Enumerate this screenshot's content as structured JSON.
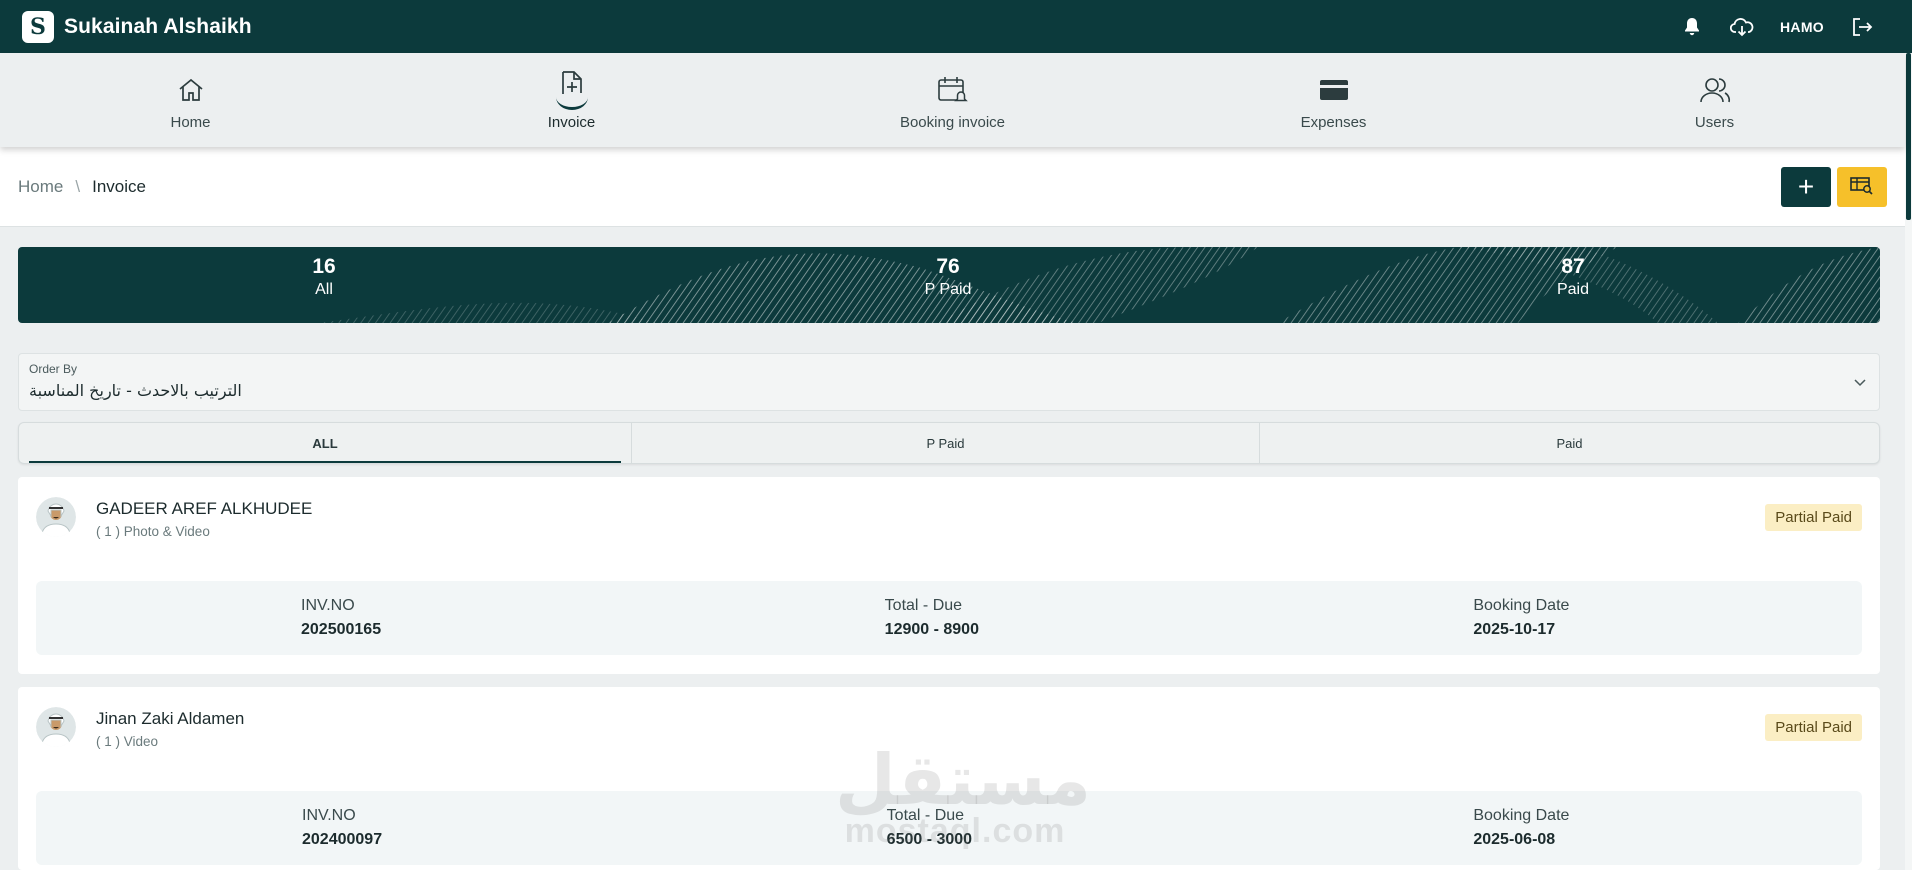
{
  "app": {
    "title": "Sukainah Alshaikh",
    "logo_letter": "S",
    "user": "HAMO"
  },
  "nav": {
    "items": [
      {
        "label": "Home",
        "icon": "home-icon"
      },
      {
        "label": "Invoice",
        "icon": "invoice-add-icon"
      },
      {
        "label": "Booking invoice",
        "icon": "calendar-bell-icon"
      },
      {
        "label": "Expenses",
        "icon": "wallet-card-icon"
      },
      {
        "label": "Users",
        "icon": "users-icon"
      }
    ]
  },
  "breadcrumb": {
    "home": "Home",
    "separator": "\\",
    "current": "Invoice"
  },
  "actions": {
    "add_label": "+"
  },
  "stats": [
    {
      "value": "16",
      "label": "All"
    },
    {
      "value": "76",
      "label": "P Paid"
    },
    {
      "value": "87",
      "label": "Paid"
    }
  ],
  "order_by": {
    "label": "Order By",
    "value": "الترتيب بالاحدث - تاريخ المناسبة"
  },
  "tabs": [
    {
      "label": "ALL"
    },
    {
      "label": "P Paid"
    },
    {
      "label": "Paid"
    }
  ],
  "labels": {
    "inv_no": "INV.NO",
    "total_due": "Total - Due",
    "booking_date": "Booking Date"
  },
  "invoices": [
    {
      "name": "GADEER AREF ALKHUDEE",
      "service": "( 1 ) Photo & Video",
      "status": "Partial Paid",
      "inv_no": "202500165",
      "total_due": "12900 - 8900",
      "booking_date": "2025-10-17"
    },
    {
      "name": "Jinan Zaki Aldamen",
      "service": "( 1 ) Video",
      "status": "Partial Paid",
      "inv_no": "202400097",
      "total_due": "6500 - 3000",
      "booking_date": "2025-06-08"
    }
  ],
  "watermark": {
    "arabic": "مستقل",
    "latin": "mostaql.com"
  },
  "colors": {
    "primary": "#0c3a3c",
    "accent": "#f6c02a",
    "badge_bg": "#fbeec4"
  }
}
